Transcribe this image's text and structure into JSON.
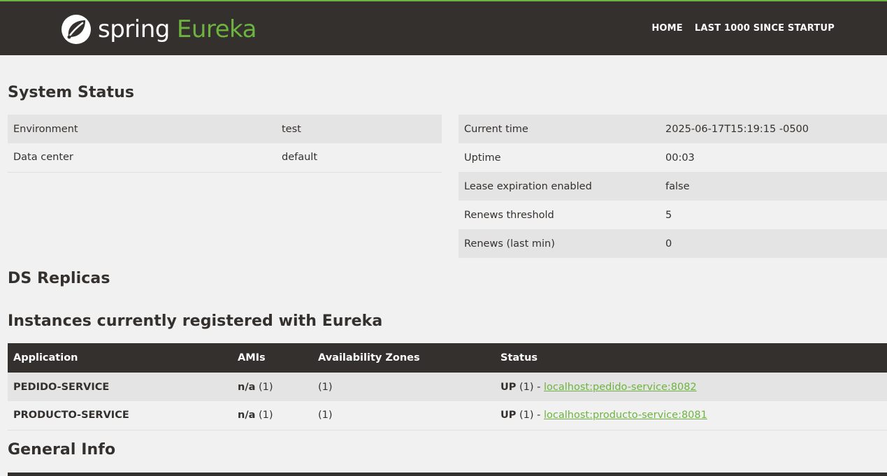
{
  "brand": {
    "spring": "spring",
    "eureka": "Eureka"
  },
  "nav": {
    "home": "HOME",
    "last1000": "LAST 1000 SINCE STARTUP"
  },
  "headings": {
    "system_status": "System Status",
    "ds_replicas": "DS Replicas",
    "instances": "Instances currently registered with Eureka",
    "general_info": "General Info"
  },
  "system_left": [
    {
      "key": "Environment",
      "value": "test"
    },
    {
      "key": "Data center",
      "value": "default"
    }
  ],
  "system_right": [
    {
      "key": "Current time",
      "value": "2025-06-17T15:19:15 -0500"
    },
    {
      "key": "Uptime",
      "value": "00:03"
    },
    {
      "key": "Lease expiration enabled",
      "value": "false"
    },
    {
      "key": "Renews threshold",
      "value": "5"
    },
    {
      "key": "Renews (last min)",
      "value": "0"
    }
  ],
  "instances": {
    "columns": [
      "Application",
      "AMIs",
      "Availability Zones",
      "Status"
    ],
    "rows": [
      {
        "application": "PEDIDO-SERVICE",
        "ami": "n/a",
        "ami_count": "(1)",
        "zones": "(1)",
        "status": "UP",
        "status_count": "(1) -",
        "link": "localhost:pedido-service:8082"
      },
      {
        "application": "PRODUCTO-SERVICE",
        "ami": "n/a",
        "ami_count": "(1)",
        "zones": "(1)",
        "status": "UP",
        "status_count": "(1) -",
        "link": "localhost:producto-service:8081"
      }
    ]
  },
  "colors": {
    "dark": "#34302d",
    "accent": "#6db33f",
    "background": "#f1f1f1",
    "stripe": "#e4e4e4"
  },
  "icons": {
    "logo": "spring-leaf-icon"
  }
}
